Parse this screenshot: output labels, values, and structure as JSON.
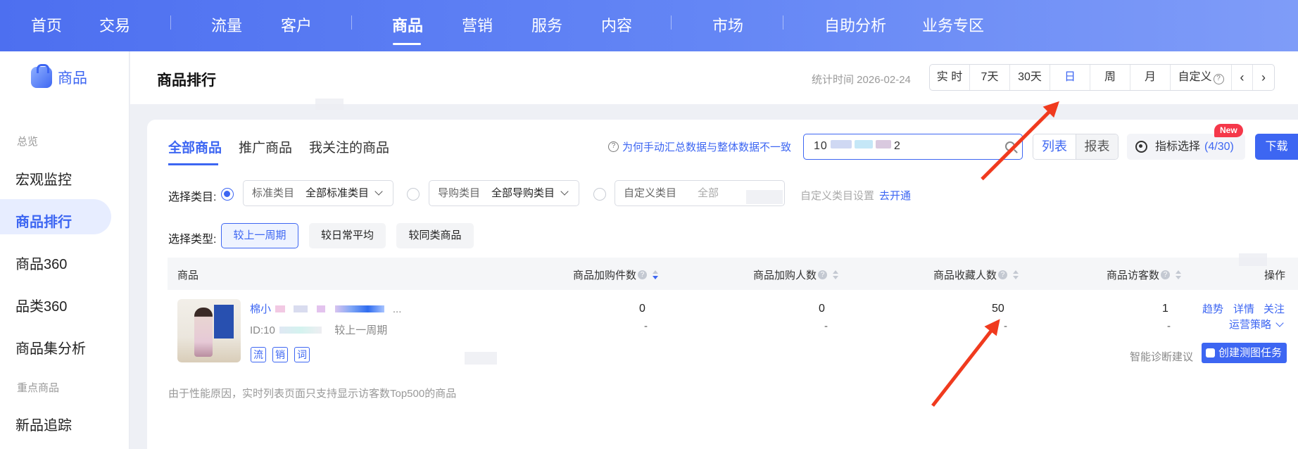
{
  "topnav": {
    "items": [
      "首页",
      "交易",
      "流量",
      "客户",
      "商品",
      "营销",
      "服务",
      "内容",
      "市场",
      "自助分析",
      "业务专区"
    ],
    "active": "商品"
  },
  "sidebar": {
    "brand": "商品",
    "groups": [
      "总览",
      "重点商品"
    ],
    "items": [
      "宏观监控",
      "商品排行",
      "商品360",
      "品类360",
      "商品集分析",
      "新品追踪"
    ],
    "active": "商品排行"
  },
  "header": {
    "title": "商品排行",
    "stat_time": "统计时间 2026-02-24",
    "periods": [
      "实 时",
      "7天",
      "30天",
      "日",
      "周",
      "月",
      "自定义"
    ],
    "active_period": "日"
  },
  "tabs": [
    "全部商品",
    "推广商品",
    "我关注的商品"
  ],
  "toolbar": {
    "help_text": "为何手动汇总数据与整体数据不一致",
    "search_value": "10",
    "search_suffix": "2",
    "view_list": "列表",
    "view_report": "报表",
    "metric_label": "指标选择",
    "metric_count": "(4/30)",
    "new_badge": "New",
    "download": "下载"
  },
  "filters": {
    "category_label": "选择类目:",
    "standard_key": "标准类目",
    "standard_value": "全部标准类目",
    "guide_key": "导购类目",
    "guide_value": "全部导购类目",
    "custom_key": "自定义类目",
    "custom_placeholder": "全部",
    "custom_settings": "自定义类目设置",
    "open_link": "去开通",
    "type_label": "选择类型:",
    "types": [
      "较上一周期",
      "较日常平均",
      "较同类商品"
    ],
    "active_type": "较上一周期"
  },
  "table": {
    "headers": [
      "商品",
      "商品加购件数",
      "商品加购人数",
      "商品收藏人数",
      "商品访客数",
      "操作"
    ],
    "row": {
      "name": "棉小",
      "name_suffix": "...",
      "id_prefix": "ID:10",
      "compare": "较上一周期",
      "tags": [
        "流",
        "销",
        "词"
      ],
      "values": [
        "0",
        "0",
        "50",
        "1"
      ],
      "changes": [
        "-",
        "-",
        "-",
        "-"
      ],
      "ops": [
        "趋势",
        "详情",
        "关注"
      ],
      "strategy": "运营策略",
      "diagnosis": "智能诊断建议",
      "create_task": "创建测图任务"
    }
  },
  "footer_note": "由于性能原因，实时列表页面只支持显示访客数Top500的商品",
  "colors": {
    "accent": "#3d66f2",
    "topbar": "#5b7bf3",
    "arrow": "#f03a1e",
    "badge": "#f5384a"
  }
}
